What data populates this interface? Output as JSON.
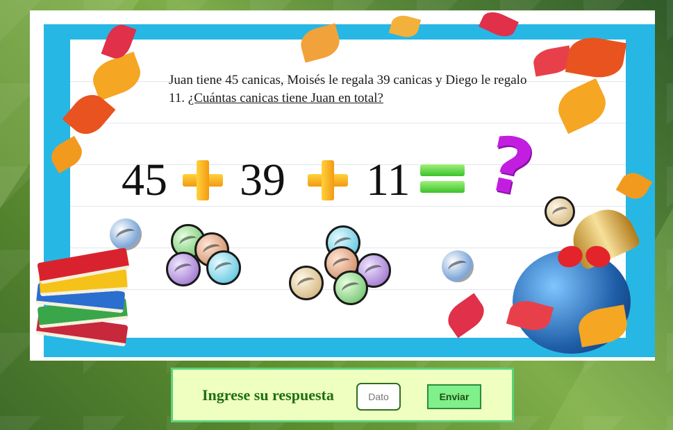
{
  "problem": {
    "text": "Juan tiene 45 canicas, Moisés le regala 39 canicas y Diego le regalo 11.",
    "question": "¿Cuántas canicas tiene Juan en total?"
  },
  "equation": {
    "a": "45",
    "b": "39",
    "c": "11",
    "unknown": "?"
  },
  "answer_form": {
    "label": "Ingrese su respuesta",
    "placeholder": "Dato",
    "submit_label": "Enviar"
  },
  "colors": {
    "frame": "#27b7e4",
    "plus": "#f39a12",
    "equals": "#3cc12a",
    "question_mark": "#c21ee0",
    "panel_bg": "#eeffc0",
    "panel_border": "#5ad47a",
    "label": "#1f6f12"
  }
}
